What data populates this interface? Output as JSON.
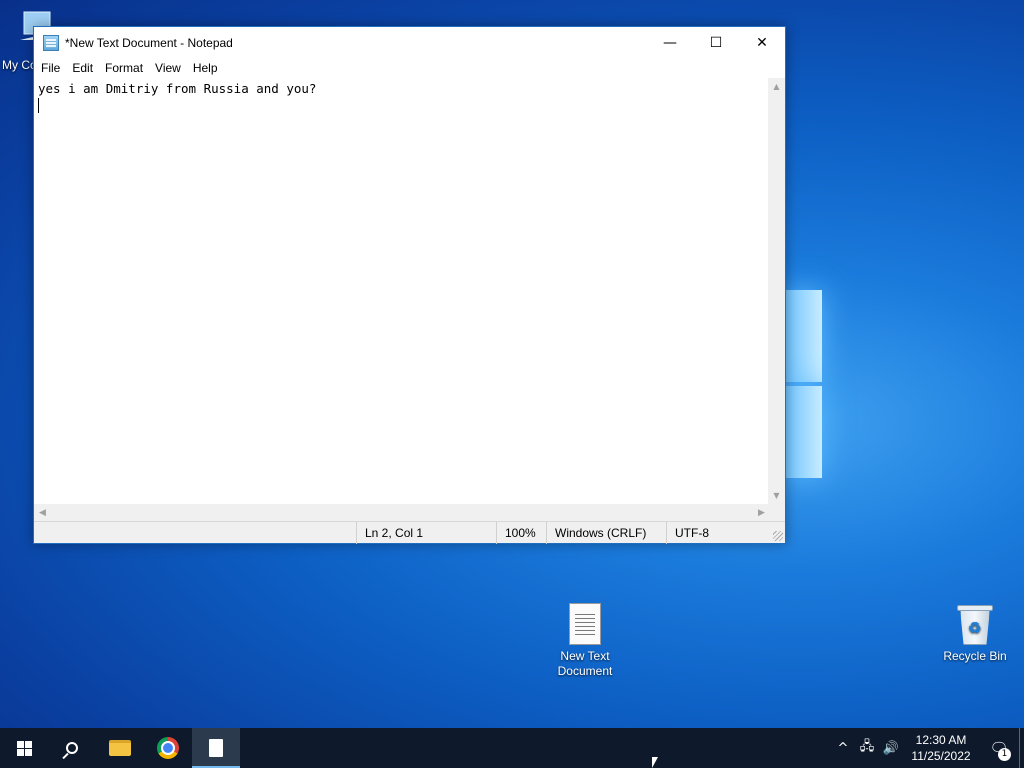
{
  "desktop": {
    "icons": [
      {
        "label": "My Co"
      },
      {
        "label_line1": "New Text",
        "label_line2": "Document"
      },
      {
        "label": "Recycle Bin"
      }
    ]
  },
  "notepad": {
    "title": "*New Text Document - Notepad",
    "menu": [
      "File",
      "Edit",
      "Format",
      "View",
      "Help"
    ],
    "content": "yes i am Dmitriy from Russia and you?",
    "status": {
      "position": "Ln 2, Col 1",
      "zoom": "100%",
      "line_ending": "Windows (CRLF)",
      "encoding": "UTF-8"
    },
    "controls": {
      "minimize": "—",
      "maximize": "☐",
      "close": "✕"
    }
  },
  "taskbar": {
    "apps": [
      "start-icon",
      "search-icon",
      "file-explorer-icon",
      "chrome-icon",
      "notepad-icon"
    ],
    "tray": {
      "chevron": "^",
      "network": "🖧",
      "volume": "🔊",
      "time": "12:30 AM",
      "date": "11/25/2022",
      "notification_count": "1"
    }
  },
  "colors": {
    "accent": "#0078d7",
    "taskbar": "#0e1a2b",
    "wallpaper": "#0d5fc4"
  }
}
